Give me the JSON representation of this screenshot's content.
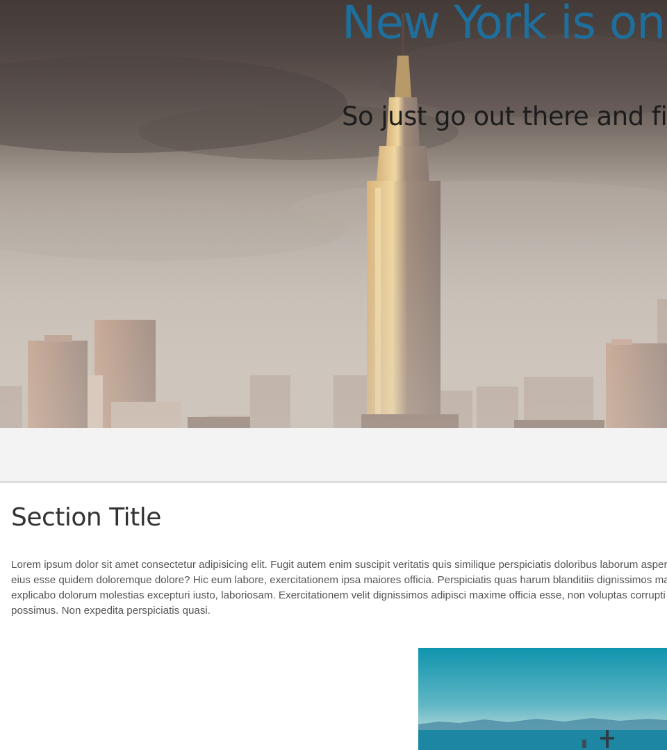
{
  "hero": {
    "title": "New York is one of a kind",
    "subtitle": "So just go out there and find it"
  },
  "section": {
    "title": "Section Title",
    "body": "Lorem ipsum dolor sit amet consectetur adipisicing elit. Fugit autem enim suscipit veritatis quis similique perspiciatis doloribus laborum aspernatur sit eius esse quidem doloremque dolore? Hic eum labore, exercitationem ipsa maiores officia. Perspiciatis quas harum blanditiis dignissimos magnam explicabo dolorum molestias excepturi iusto, laboriosam. Exercitationem velit dignissimos adipisci maxime officia esse, non voluptas corrupti facere possimus. Non expedita perspiciatis quasi."
  },
  "colors": {
    "title_accent": "#1f6f9c",
    "text_dark": "#333333",
    "band_background": "#f3f3f3"
  }
}
